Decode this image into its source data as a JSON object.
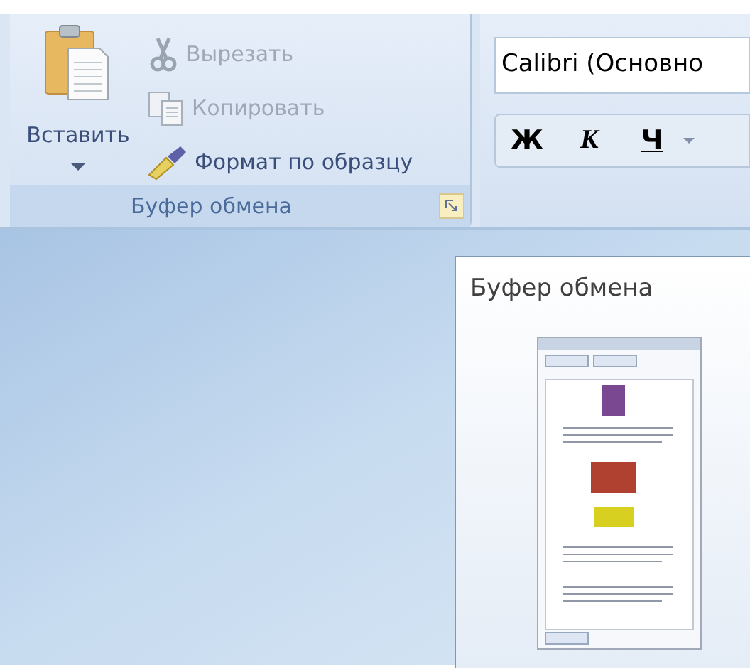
{
  "clipboard_group": {
    "paste_button": {
      "label": "Вставить"
    },
    "commands": [
      {
        "kind": "cut",
        "label": "Вырезать",
        "disabled": true
      },
      {
        "kind": "copy",
        "label": "Копировать",
        "disabled": true
      },
      {
        "kind": "format",
        "label": "Формат по образцу",
        "disabled": false
      }
    ],
    "group_label": "Буфер обмена"
  },
  "font_group": {
    "font_field": {
      "value": "Calibri (Основно"
    },
    "buttons": [
      {
        "kind": "bold",
        "label": "Ж"
      },
      {
        "kind": "italic",
        "label": "К"
      },
      {
        "kind": "underline",
        "label": "Ч"
      }
    ]
  },
  "tooltip": {
    "title": "Буфер обмена"
  }
}
